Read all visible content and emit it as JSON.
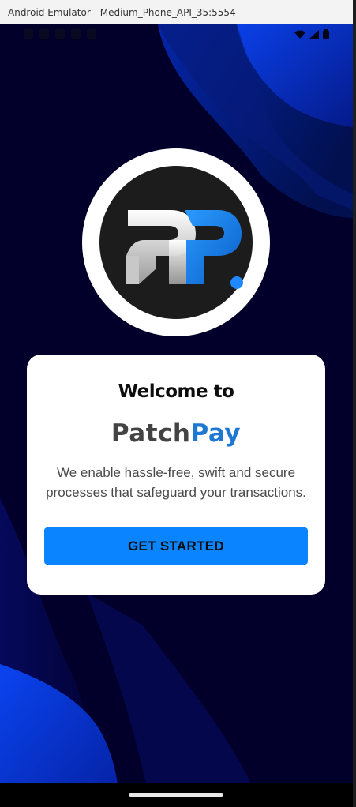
{
  "window": {
    "title": "Android Emulator - Medium_Phone_API_35:5554"
  },
  "status_bar": {
    "left_icons": [
      "notification-icon",
      "notification-icon",
      "notification-icon",
      "notification-icon",
      "notification-icon"
    ],
    "right_icons": [
      "wifi-icon",
      "signal-icon",
      "battery-icon"
    ]
  },
  "logo": {
    "alt": "PP."
  },
  "welcome": {
    "heading": "Welcome to",
    "brand_part1": "Patch",
    "brand_part2": "Pay",
    "description": "We enable hassle-free, swift and secure processes that safeguard your transactions.",
    "cta_label": "GET STARTED"
  },
  "colors": {
    "background": "#02002a",
    "accent": "#0a84ff",
    "brand_blue": "#1e78d2",
    "wave_blue": "#0b37c9"
  }
}
